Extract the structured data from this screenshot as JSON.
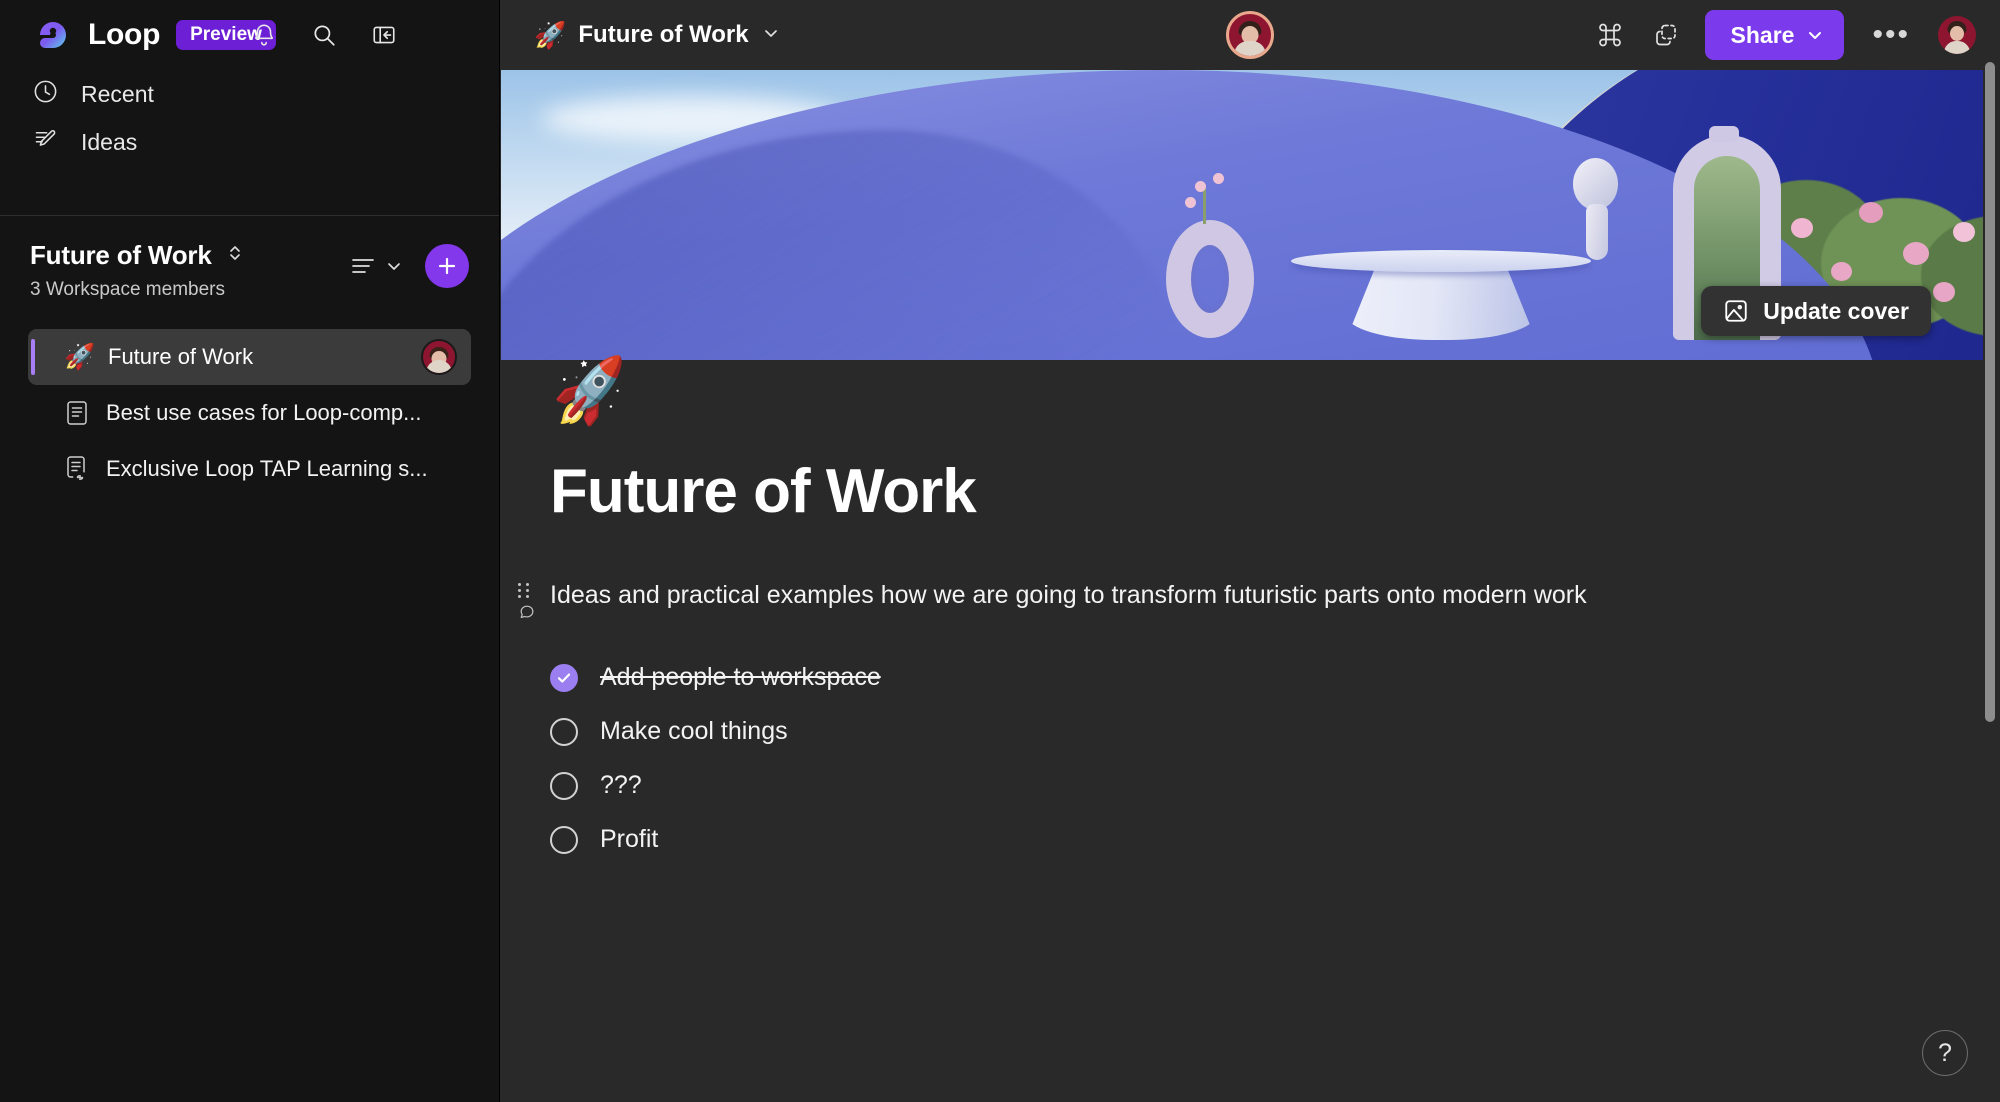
{
  "app": {
    "brand_name": "Loop",
    "preview_badge": "Preview"
  },
  "sidebar": {
    "icons": {
      "notifications": "bell-icon",
      "search": "search-icon",
      "collapse": "collapse-panel-icon"
    },
    "nav_items": [
      {
        "label": "Recent",
        "icon": "clock-icon"
      },
      {
        "label": "Ideas",
        "icon": "pencil-lines-icon"
      }
    ],
    "workspace": {
      "title": "Future of Work",
      "members": "3 Workspace members",
      "sort_icon": "sort-lines-icon",
      "add_label": "+"
    },
    "documents": [
      {
        "label": "Future of Work",
        "emoji": "🚀",
        "active": true,
        "icon": "",
        "has_avatar": true
      },
      {
        "label": "Best use cases for Loop-comp...",
        "emoji": "",
        "active": false,
        "icon": "page-icon",
        "has_avatar": false
      },
      {
        "label": "Exclusive Loop TAP Learning s...",
        "emoji": "",
        "active": false,
        "icon": "page-link-icon",
        "has_avatar": false
      }
    ]
  },
  "topbar": {
    "breadcrumb_emoji": "🚀",
    "breadcrumb_title": "Future of Work",
    "chevron": "chevron-down-icon",
    "apps_icon": "apps-grid-icon",
    "copy_icon": "copy-dashed-icon",
    "share_label": "Share",
    "more_label": "•••"
  },
  "cover": {
    "update_label": "Update cover",
    "update_icon": "image-icon"
  },
  "document": {
    "page_emoji": "🚀",
    "title": "Future of Work",
    "paragraph": "Ideas and practical examples how we are going to transform futuristic parts onto modern work",
    "tasks": [
      {
        "label": "Add people to workspace",
        "checked": true
      },
      {
        "label": "Make cool things",
        "checked": false
      },
      {
        "label": "???",
        "checked": false
      },
      {
        "label": "Profit",
        "checked": false
      }
    ]
  },
  "help": {
    "label": "?"
  },
  "colors": {
    "accent_purple": "#7c3aed",
    "add_button_purple": "#8338ec",
    "preview_badge_purple": "#6c1fd4",
    "checkbox_purple": "#9b7ef0",
    "sidebar_bg": "#141414",
    "main_bg": "#292929",
    "active_item_bg": "#3b3b3b"
  }
}
